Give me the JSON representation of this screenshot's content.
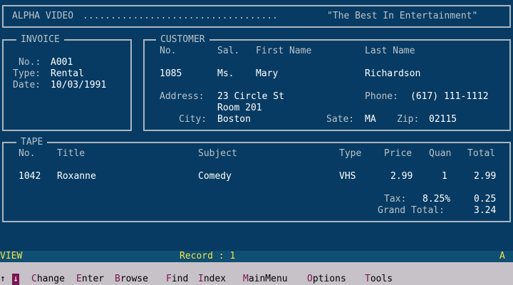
{
  "header": {
    "app": "ALPHA VIDEO",
    "dots": "...................................",
    "slogan": "\"The Best In Entertainment\""
  },
  "invoice": {
    "legend": "INVOICE",
    "no_label": "No.:",
    "no": "A001",
    "type_label": "Type:",
    "type": "Rental",
    "date_label": "Date:",
    "date": "10/03/1991"
  },
  "customer": {
    "legend": "CUSTOMER",
    "h_no": "No.",
    "h_sal": "Sal.",
    "h_first": "First Name",
    "h_last": "Last Name",
    "no": "1085",
    "sal": "Ms.",
    "first": "Mary",
    "last": "Richardson",
    "address_label": "Address:",
    "address1": "23 Circle St",
    "address2": "Room 201",
    "phone_label": "Phone:",
    "phone": "(617) 111-1112",
    "city_label": "City:",
    "city": "Boston",
    "state_label": "Sate:",
    "state": "MA",
    "zip_label": "Zip:",
    "zip": "02115"
  },
  "tape": {
    "legend": "TAPE",
    "h_no": "No.",
    "h_title": "Title",
    "h_subject": "Subject",
    "h_type": "Type",
    "h_price": "Price",
    "h_quan": "Quan",
    "h_total": "Total",
    "row": {
      "no": "1042",
      "title": "Roxanne",
      "subject": "Comedy",
      "type": "VHS",
      "price": "2.99",
      "quan": "1",
      "total": "2.99"
    },
    "tax_label": "Tax:",
    "tax_rate": "8.25%",
    "tax": "0.25",
    "grand_label": "Grand Total:",
    "grand": "3.24"
  },
  "status": {
    "mode": "VIEW",
    "record_label": "Record : 1",
    "drive": "A"
  },
  "menu": {
    "up": "↑",
    "down": "↓",
    "change_hot": "C",
    "change_rest": "hange",
    "enter_hot": "E",
    "enter_rest": "nter",
    "browse_hot": "B",
    "browse_rest": "rowse",
    "find_hot": "F",
    "find_rest": "ind",
    "index_hot": "I",
    "index_rest": "ndex",
    "main_hot": "M",
    "main_rest": "ainMenu",
    "options_hot": "O",
    "options_rest": "ptions",
    "tools_hot": "T",
    "tools_rest": "ools"
  }
}
